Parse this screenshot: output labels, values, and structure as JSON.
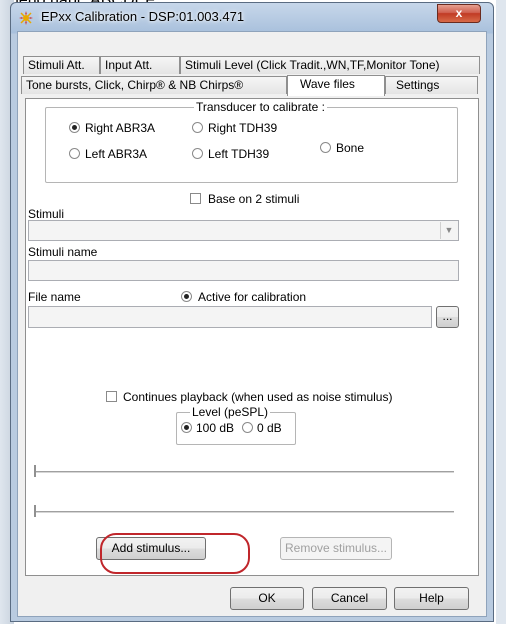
{
  "page": {
    "top_text": "jméno např. ABCDEF."
  },
  "window": {
    "title": "EPxx Calibration - DSP:01.003.471",
    "close_label": "x"
  },
  "tabs_row1": [
    {
      "label": "Stimuli Att."
    },
    {
      "label": "Input Att."
    },
    {
      "label": "Stimuli Level (Click Tradit.,WN,TF,Monitor Tone)"
    }
  ],
  "tabs_row2": [
    {
      "label": "Tone bursts, Click, Chirp® & NB Chirps®"
    },
    {
      "label": "Wave files"
    },
    {
      "label": "Settings"
    }
  ],
  "transducer": {
    "title": "Transducer to calibrate :",
    "options": [
      {
        "label": "Right ABR3A",
        "selected": true
      },
      {
        "label": "Right TDH39",
        "selected": false
      },
      {
        "label": "Bone",
        "selected": false
      },
      {
        "label": "Left ABR3A",
        "selected": false
      },
      {
        "label": "Left TDH39",
        "selected": false
      }
    ]
  },
  "form": {
    "base_on_2_label": "Base on 2 stimuli",
    "stimuli_label": "Stimuli",
    "stimuli_value": "",
    "stimuli_name_label": "Stimuli name",
    "stimuli_name_value": "",
    "file_name_label": "File name",
    "file_name_value": "",
    "active_label": "Active for calibration",
    "browse_label": "...",
    "continues_label": "Continues playback (when used as noise stimulus)"
  },
  "level": {
    "title": "Level (peSPL)",
    "options": [
      {
        "label": "100 dB",
        "selected": true
      },
      {
        "label": "0 dB",
        "selected": false
      }
    ]
  },
  "buttons": {
    "add_label": "Add stimulus...",
    "remove_label": "Remove stimulus...",
    "ok_label": "OK",
    "cancel_label": "Cancel",
    "help_label": "Help"
  }
}
